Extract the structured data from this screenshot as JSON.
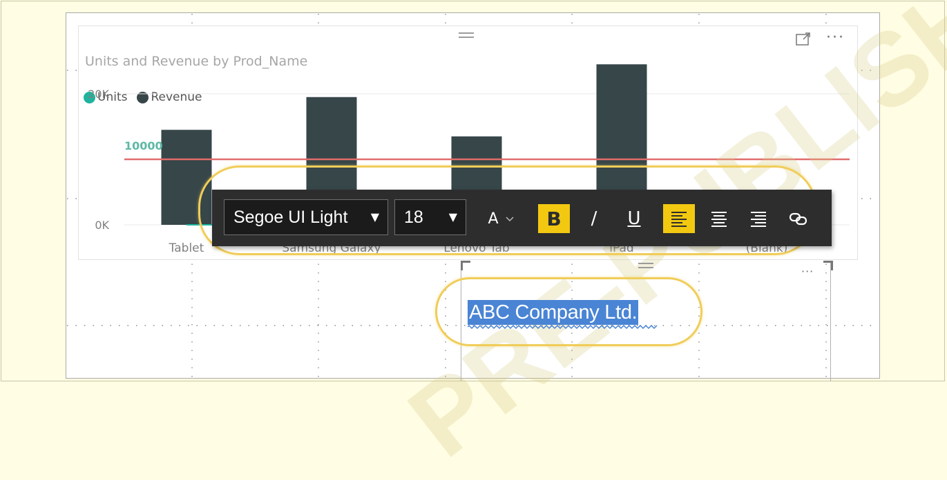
{
  "watermark": "PRE-PUBLISHED",
  "chart_visual": {
    "title": "Units and Revenue by Prod_Name",
    "focus_icon": "focus-mode-icon",
    "more_icon_label": "···"
  },
  "legend": [
    {
      "name": "Units",
      "color": "#1fb39e"
    },
    {
      "name": "Revenue",
      "color": "#374649"
    }
  ],
  "chart_data": {
    "type": "bar",
    "title": "Units and Revenue by Prod_Name",
    "categories": [
      "Tablet",
      "Samsung Galaxy",
      "Lenovo Tab",
      "iPad",
      "(Blank)"
    ],
    "series": [
      {
        "name": "Revenue",
        "type": "bar",
        "color": "#374649",
        "values": [
          14500,
          19500,
          13500,
          24500,
          0
        ]
      },
      {
        "name": "Units",
        "type": "line",
        "color": "#1fb39e",
        "values": [
          0,
          0,
          0,
          0,
          0
        ]
      }
    ],
    "y_ticks": [
      "0K",
      "20K"
    ],
    "ylim": [
      0,
      28000
    ],
    "reference_line": {
      "label": "10000",
      "value": 10000,
      "color": "#e16b6b"
    },
    "legend_position": "top-left",
    "grid": true
  },
  "toolbar": {
    "font_family": "Segoe UI Light",
    "font_size": "18",
    "font_color_label": "A",
    "bold_label": "B",
    "italic_label": "/",
    "underline_label": "U",
    "dropdown_arrow": "▼"
  },
  "textbox": {
    "text": "ABC Company Ltd.",
    "more_label": "···"
  },
  "colors": {
    "accent": "#f2c811",
    "highlight": "#f0cd5a",
    "selection": "#4a84d4",
    "toolbar_bg": "#2d2d2d"
  }
}
